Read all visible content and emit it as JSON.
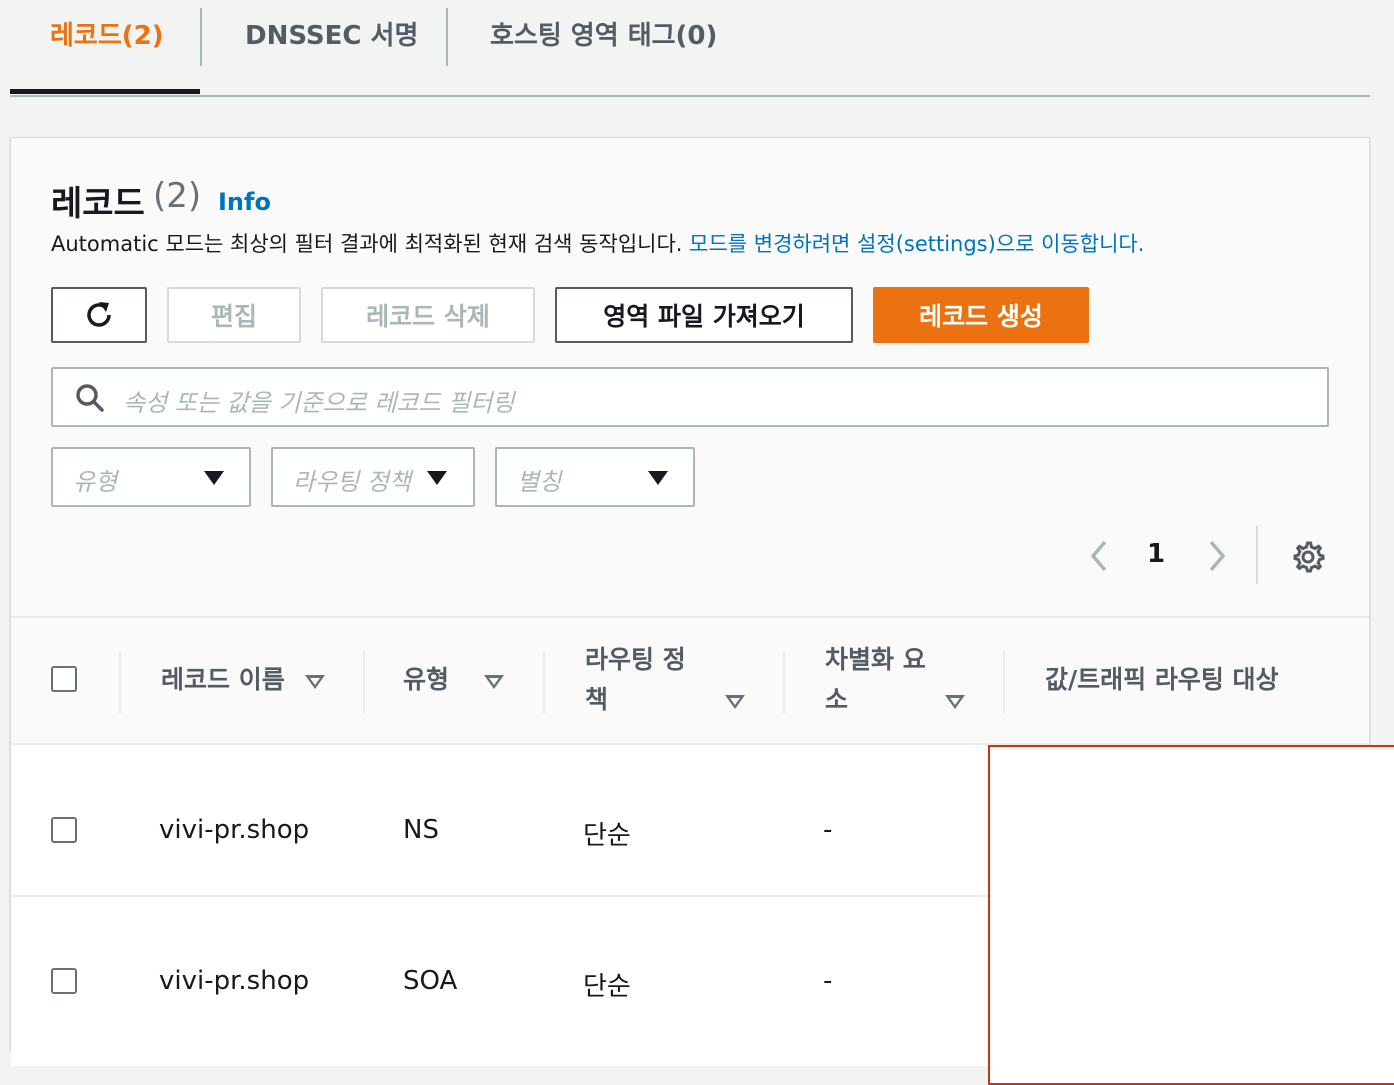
{
  "tabs": {
    "records": "레코드(2)",
    "dnssec": "DNSSEC 서명",
    "tags": "호스팅 영역 태그(0)"
  },
  "panel": {
    "title": "레코드",
    "count": "(2)",
    "info": "Info",
    "desc_text": "Automatic 모드는 최상의 필터 결과에 최적화된 현재 검색 동작입니다.",
    "desc_link": "모드를 변경하려면 설정(settings)으로 이동합니다."
  },
  "toolbar": {
    "refresh_icon": "refresh-icon",
    "edit": "편집",
    "delete": "레코드 삭제",
    "import": "영역 파일 가져오기",
    "create": "레코드 생성"
  },
  "search": {
    "placeholder": "속성 또는 값을 기준으로 레코드 필터링"
  },
  "filters": {
    "type": "유형",
    "routing": "라우팅 정책",
    "alias": "별칭"
  },
  "pagination": {
    "page": "1"
  },
  "table": {
    "headers": {
      "name": "레코드 이름",
      "type": "유형",
      "routing_l1": "라우팅 정",
      "routing_l2": "책",
      "diff_l1": "차별화 요",
      "diff_l2": "소",
      "value": "값/트래픽 라우팅 대상"
    },
    "rows": [
      {
        "name": "vivi-pr.shop",
        "type": "NS",
        "routing": "단순",
        "diff": "-"
      },
      {
        "name": "vivi-pr.shop",
        "type": "SOA",
        "routing": "단순",
        "diff": "-"
      }
    ]
  },
  "colors": {
    "accent": "#ec7211",
    "link": "#0073bb",
    "overlay_border": "#d13212"
  }
}
